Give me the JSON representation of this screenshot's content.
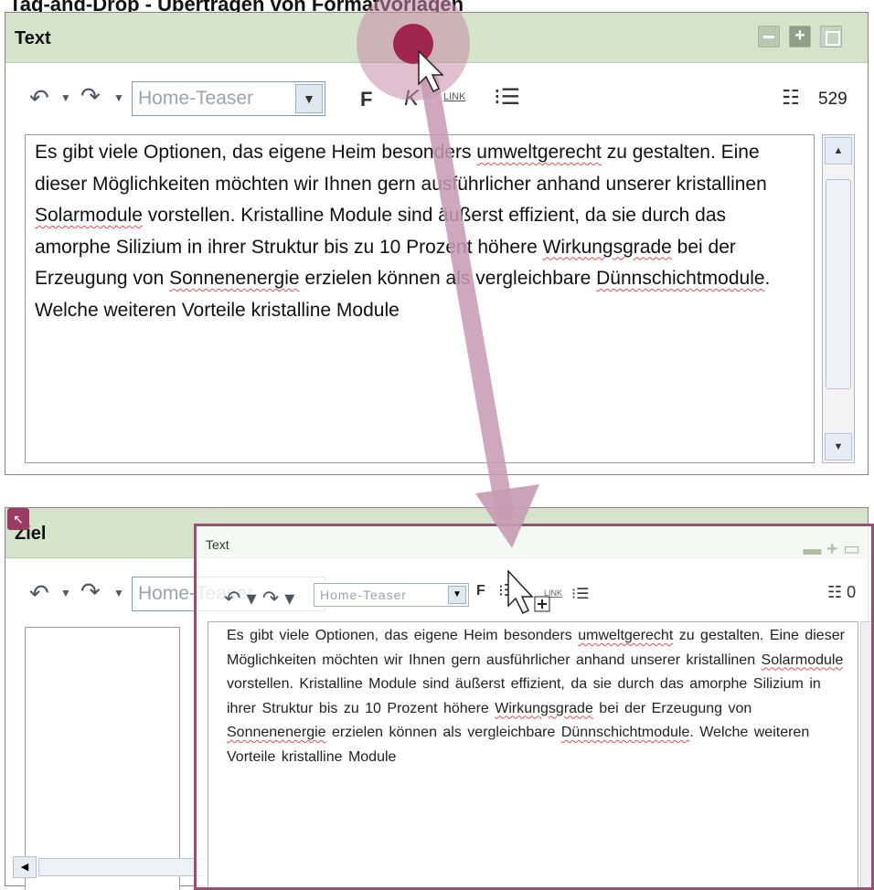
{
  "page_heading": "Tag-and-Drop - Übertragen von Formatvorlagen",
  "source_panel": {
    "title": "Text",
    "toolbar": {
      "style_select_value": "Home-Teaser",
      "bold_label": "F",
      "italic_label": "K",
      "link_label": "LINK",
      "char_count": "529"
    },
    "editor_paragraph": [
      {
        "t": "Es gibt viele Optionen, das eigene Heim besonders "
      },
      {
        "t": "umweltgerecht",
        "sp": true
      },
      {
        "t": " zu gestalten. Eine dieser Möglichkeiten möchten wir Ihnen gern ausführlicher anhand unserer kristallinen "
      },
      {
        "t": "Solarmodule",
        "sp": true
      },
      {
        "t": " vorstellen. Kristalline Module sind äußerst effizient, da sie durch das amorphe Silizium in ihrer Struktur bis zu 10 Prozent höhere "
      },
      {
        "t": "Wirkungsgrade",
        "sp": true
      },
      {
        "t": " bei der Erzeugung von "
      },
      {
        "t": "Sonnenenergie",
        "sp": true
      },
      {
        "t": " erzielen können als vergleichbare "
      },
      {
        "t": "Dünnschichtmodule",
        "sp": true
      },
      {
        "t": ". Welche weiteren Vorteile kristalline Module"
      }
    ]
  },
  "target_panel": {
    "title": "Ziel",
    "toolbar": {
      "style_select_value": "Home-Teaser",
      "char_count": "0"
    }
  },
  "drag_ghost": {
    "title": "Text",
    "style_select_value": "Home-Teaser",
    "bold_label": "F",
    "link_label": "LINK",
    "char_count": "0"
  }
}
